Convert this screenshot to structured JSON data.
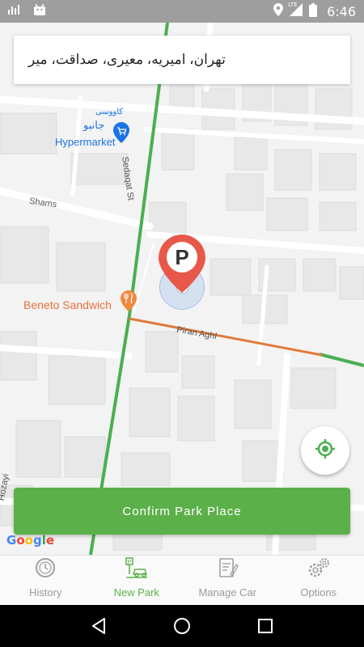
{
  "status_bar": {
    "time": "6:46",
    "network": "LTE",
    "icons": [
      "signal-bars-icon",
      "android-icon",
      "location-icon",
      "cell-signal-icon",
      "battery-icon"
    ]
  },
  "map": {
    "address": "تهران، امیریه، معیری، صداقت، میر",
    "pois": [
      {
        "name": "Hypermarket",
        "name_fa": "جانبو",
        "name_fa_small": "كاووسى",
        "color": "#1a73e8"
      },
      {
        "name": "Beneto Sandwich",
        "color": "#e8703a"
      }
    ],
    "streets": [
      "Sedaqat St",
      "Shams",
      "Piran Aghl",
      "Hozayi"
    ],
    "pin_letter": "P",
    "pin_color": "#e8584a",
    "route_color_green": "#4caf50",
    "route_color_orange": "#e07a3a",
    "google_label": "Google"
  },
  "confirm_button": {
    "label": "Confirm Park Place",
    "color": "#5cb04a"
  },
  "bottom_nav": {
    "items": [
      {
        "label": "History",
        "icon": "history-icon",
        "active": false
      },
      {
        "label": "New Park",
        "icon": "new-park-icon",
        "active": true
      },
      {
        "label": "Manage Car",
        "icon": "manage-car-icon",
        "active": false
      },
      {
        "label": "Options",
        "icon": "options-icon",
        "active": false
      }
    ],
    "active_color": "#5cb04a"
  },
  "system_nav": {
    "buttons": [
      "back-icon",
      "home-icon",
      "recents-icon"
    ]
  }
}
